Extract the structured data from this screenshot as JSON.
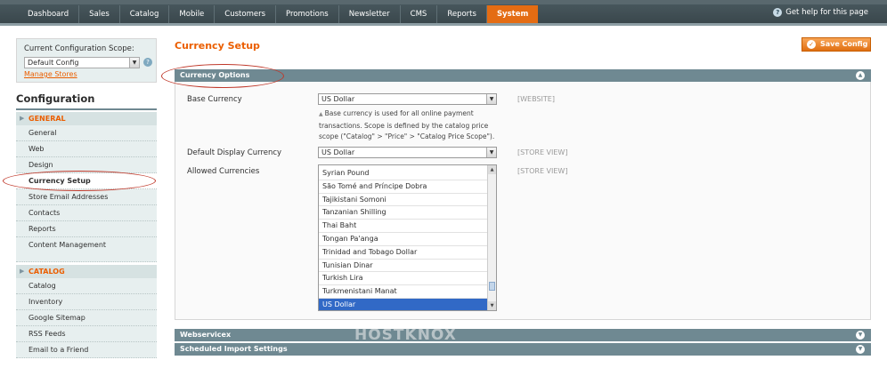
{
  "nav": {
    "items": [
      "Dashboard",
      "Sales",
      "Catalog",
      "Mobile",
      "Customers",
      "Promotions",
      "Newsletter",
      "CMS",
      "Reports",
      "System"
    ],
    "active": "System",
    "help": "Get help for this page"
  },
  "sidebar": {
    "scope_label": "Current Configuration Scope:",
    "scope_value": "Default Config",
    "manage_stores": "Manage Stores",
    "config_title": "Configuration",
    "general_title": "GENERAL",
    "general_items": [
      "General",
      "Web",
      "Design",
      "Currency Setup",
      "Store Email Addresses",
      "Contacts",
      "Reports",
      "Content Management"
    ],
    "active_item": "Currency Setup",
    "catalog_title": "CATALOG",
    "catalog_items": [
      "Catalog",
      "Inventory",
      "Google Sitemap",
      "RSS Feeds",
      "Email to a Friend"
    ]
  },
  "main": {
    "page_title": "Currency Setup",
    "save_label": "Save Config",
    "currency_options_title": "Currency Options",
    "base_currency_label": "Base Currency",
    "base_currency_value": "US Dollar",
    "base_currency_scope": "[WEBSITE]",
    "base_currency_note": "Base currency is used for all online payment transactions. Scope is defined by the catalog price scope (\"Catalog\" > \"Price\" > \"Catalog Price Scope\").",
    "display_currency_label": "Default Display Currency",
    "display_currency_value": "US Dollar",
    "display_currency_scope": "[STORE VIEW]",
    "allowed_label": "Allowed Currencies",
    "allowed_scope": "[STORE VIEW]",
    "allowed_options": [
      "Syrian Pound",
      "São Tomé and Príncipe Dobra",
      "Tajikistani Somoni",
      "Tanzanian Shilling",
      "Thai Baht",
      "Tongan Pa'anga",
      "Trinidad and Tobago Dollar",
      "Tunisian Dinar",
      "Turkish Lira",
      "Turkmenistani Manat",
      "US Dollar"
    ],
    "allowed_selected": "US Dollar",
    "webservicex_title": "Webservicex",
    "scheduled_title": "Scheduled Import Settings"
  },
  "watermark": "HOSTKNOX",
  "colors": {
    "accent": "#eb5e00",
    "nav_bg": "#3a474c",
    "header_bar": "#6f8992",
    "sidebar_bg": "#e7efef",
    "selected_option": "#3169c6",
    "annotation": "#c0392b"
  }
}
